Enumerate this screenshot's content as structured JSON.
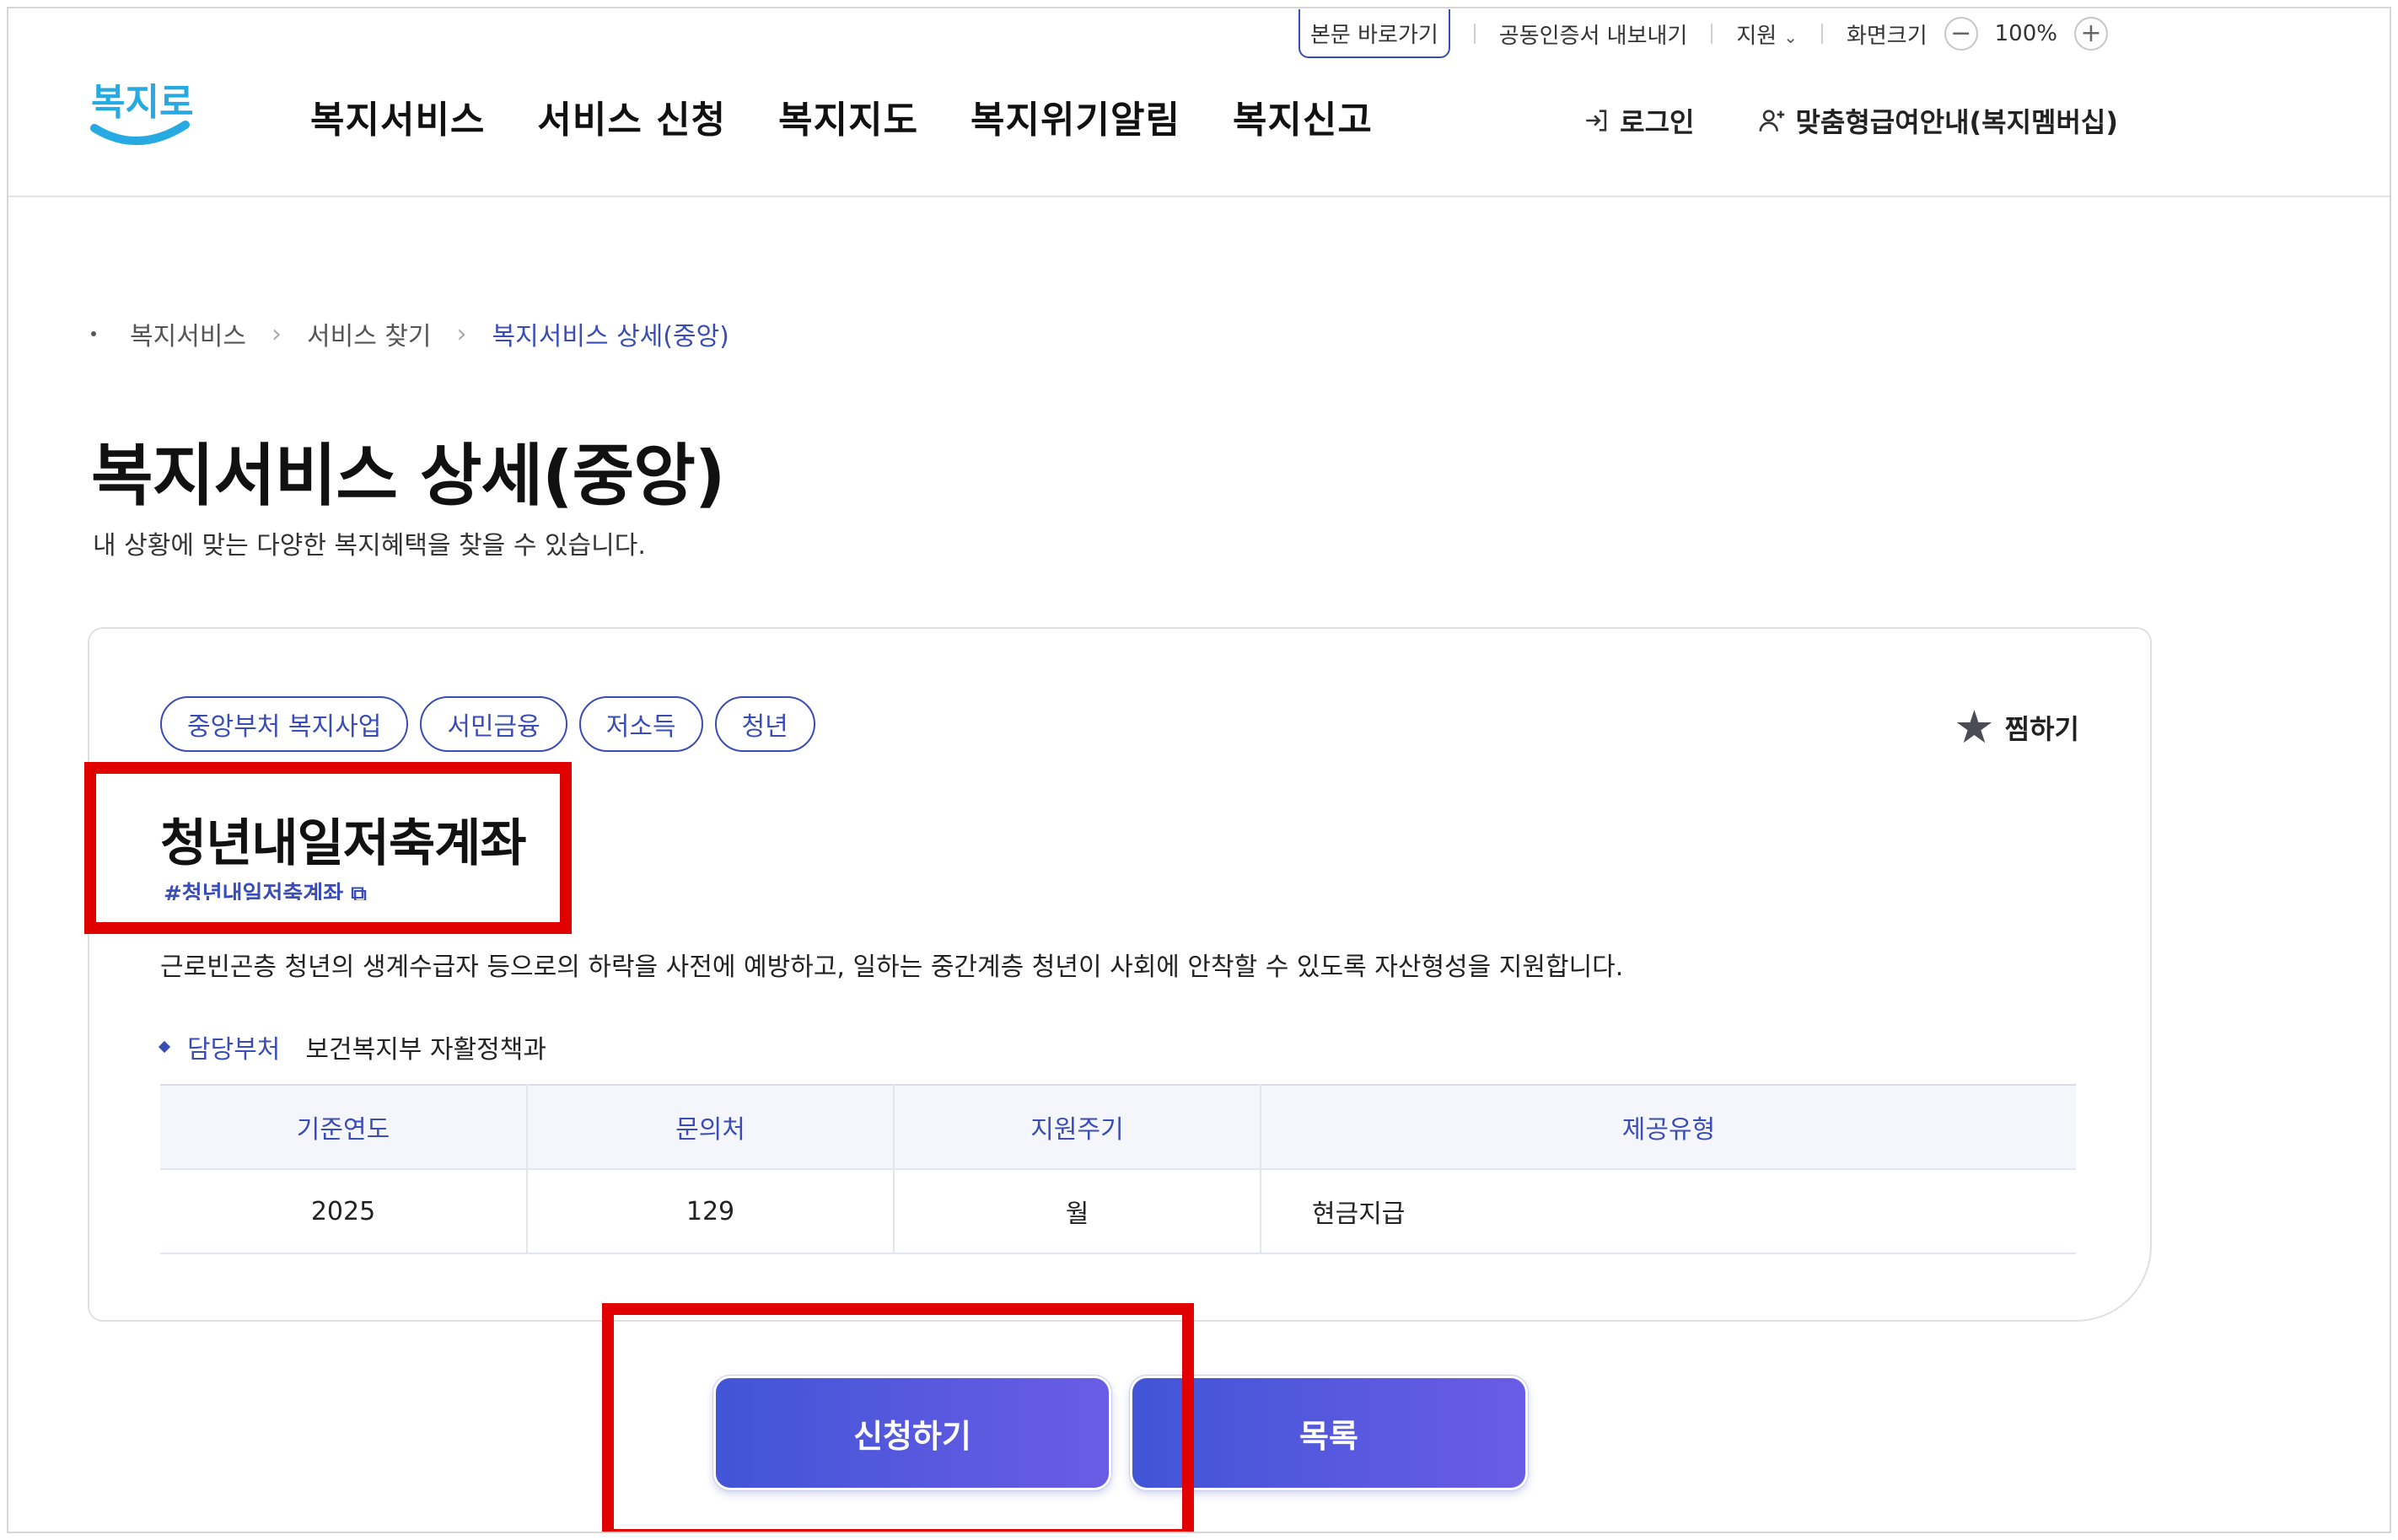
{
  "utility": {
    "skip_link": "본문 바로가기",
    "cert_export": "공동인증서 내보내기",
    "support": "지원",
    "screen_size": "화면크기",
    "zoom_level": "100%",
    "zoom_out": "−",
    "zoom_in": "+"
  },
  "header": {
    "logo_text": "복지로",
    "nav": [
      "복지서비스",
      "서비스 신청",
      "복지지도",
      "복지위기알림",
      "복지신고"
    ],
    "login": "로그인",
    "membership": "맞춤형급여안내(복지멤버십)"
  },
  "breadcrumb": [
    "복지서비스",
    "서비스 찾기",
    "복지서비스 상세(중앙)"
  ],
  "page": {
    "title": "복지서비스 상세(중앙)",
    "subtitle": "내 상황에 맞는 다양한 복지혜택을 찾을 수 있습니다."
  },
  "card": {
    "tags": [
      "중앙부처 복지사업",
      "서민금융",
      "저소득",
      "청년"
    ],
    "favorite": "찜하기",
    "service_name": "청년내일저축계좌",
    "hashtag": "#청년내일저축계좌",
    "description": "근로빈곤층 청년의 생계수급자 등으로의 하락을 사전에 예방하고, 일하는 중간계층 청년이 사회에 안착할 수 있도록 자산형성을 지원합니다.",
    "dept_label": "담당부처",
    "dept_value": "보건복지부 자활정책과",
    "table": {
      "headers": [
        "기준연도",
        "문의처",
        "지원주기",
        "제공유형"
      ],
      "row": [
        "2025",
        "129",
        "월",
        "현금지급"
      ]
    }
  },
  "buttons": {
    "apply": "신청하기",
    "list": "목록"
  },
  "colors": {
    "accent": "#3a4cb5",
    "button_from": "#4155d6",
    "button_to": "#6a5ce5",
    "highlight": "#e00000"
  }
}
